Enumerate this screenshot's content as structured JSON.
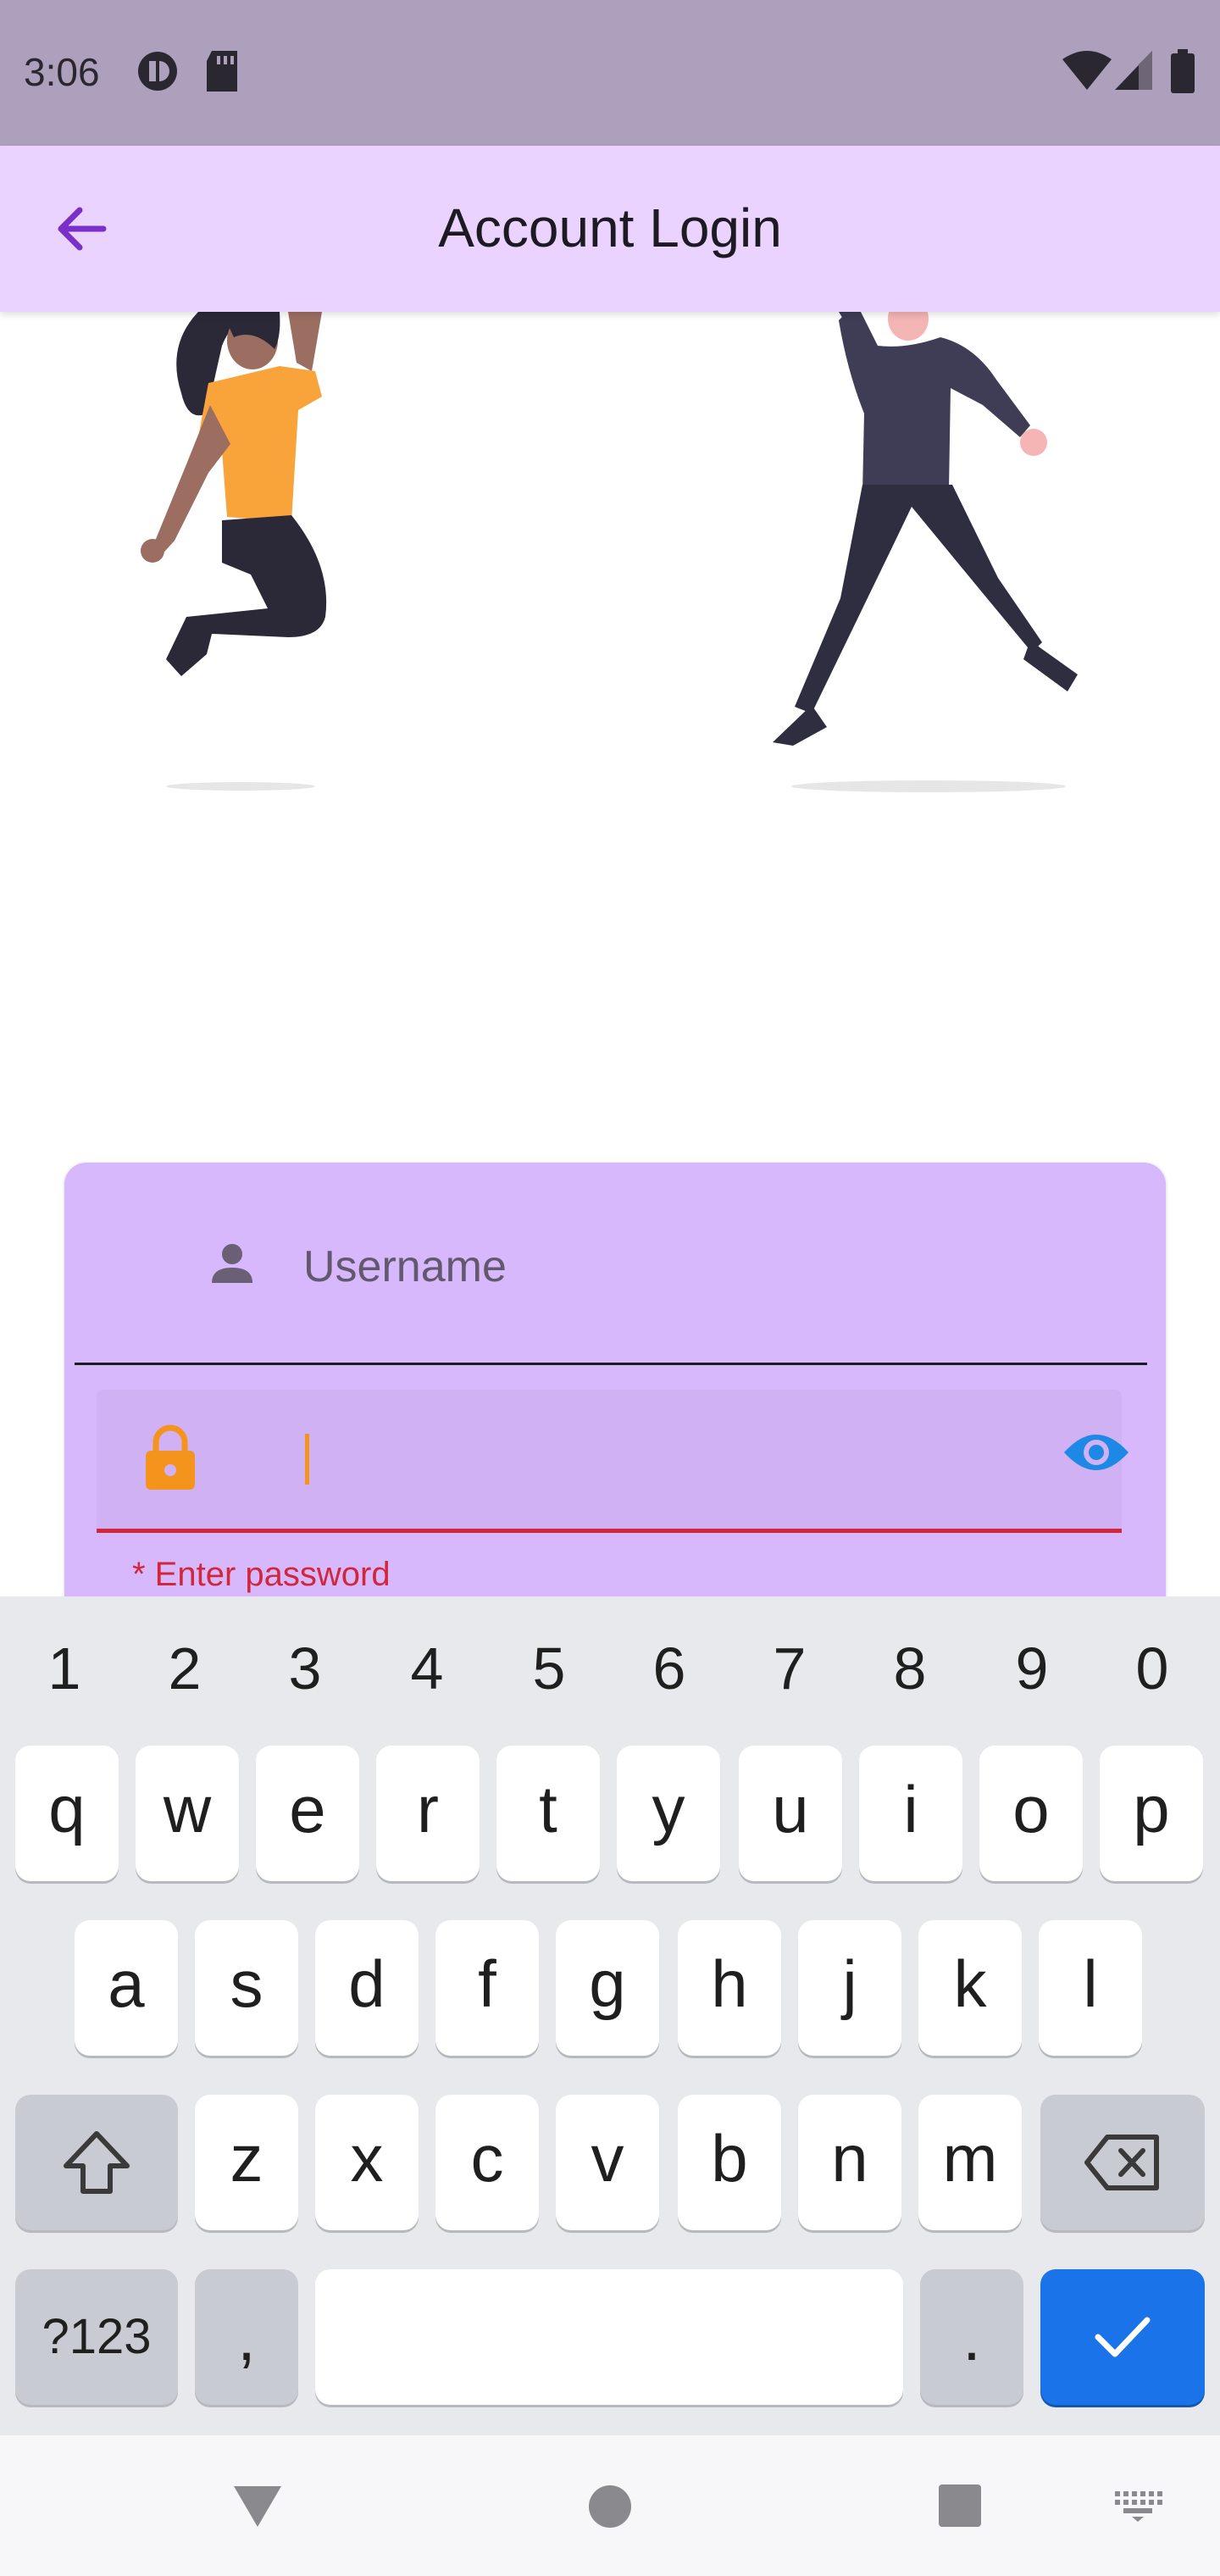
{
  "status_bar": {
    "time": "3:06",
    "left_icons": [
      "data-saver-icon",
      "sd-card-icon"
    ],
    "right_icons": [
      "wifi-icon",
      "signal-icon",
      "battery-icon"
    ],
    "background": "#ada0bd"
  },
  "app_bar": {
    "title": "Account Login",
    "back_icon": "arrow-left-icon",
    "background": "#ead4ff",
    "accent": "#7b2fc9"
  },
  "form": {
    "username_placeholder": "Username",
    "username_value": "",
    "password_value": "",
    "password_error": "* Enter password",
    "card_color": "#d7b8fc",
    "error_color": "#d2263a",
    "lock_color": "#f4941c",
    "eye_color": "#1e88e5"
  },
  "keyboard": {
    "number_row": [
      "1",
      "2",
      "3",
      "4",
      "5",
      "6",
      "7",
      "8",
      "9",
      "0"
    ],
    "row1": [
      "q",
      "w",
      "e",
      "r",
      "t",
      "y",
      "u",
      "i",
      "o",
      "p"
    ],
    "row2": [
      "a",
      "s",
      "d",
      "f",
      "g",
      "h",
      "j",
      "k",
      "l"
    ],
    "row3": [
      "z",
      "x",
      "c",
      "v",
      "b",
      "n",
      "m"
    ],
    "symbols_label": "?123",
    "comma_label": ",",
    "period_label": ".",
    "enter_icon": "check-icon",
    "shift_icon": "shift-icon",
    "backspace_icon": "backspace-icon"
  },
  "nav_bar": {
    "icons": [
      "back-triangle-icon",
      "home-circle-icon",
      "recents-square-icon",
      "keyboard-switch-icon"
    ]
  }
}
